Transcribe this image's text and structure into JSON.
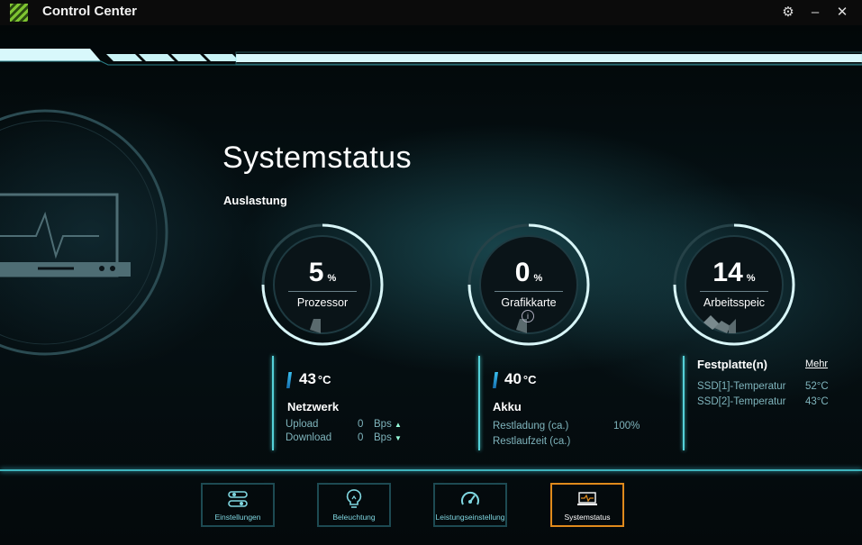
{
  "window": {
    "title": "Control Center",
    "settings_glyph": "⚙",
    "minimize_glyph": "–",
    "close_glyph": "✕"
  },
  "section": {
    "title": "Systemstatus",
    "subtitle": "Auslastung"
  },
  "gauges": [
    {
      "value": "5",
      "unit": "%",
      "label": "Prozessor",
      "level": 0.05
    },
    {
      "value": "0",
      "unit": "%",
      "label": "Grafikkarte",
      "level": 0.0,
      "info_glyph": "i"
    },
    {
      "value": "14",
      "unit": "%",
      "label": "Arbeitsspeic",
      "level": 0.14
    }
  ],
  "cpu_block": {
    "temp_value": "43",
    "temp_unit": "°C",
    "title": "Netzwerk",
    "upload_label": "Upload",
    "upload_value": "0",
    "upload_unit": "Bps",
    "download_label": "Download",
    "download_value": "0",
    "download_unit": "Bps",
    "up_arrow": "▲",
    "down_arrow": "▼"
  },
  "gpu_block": {
    "temp_value": "40",
    "temp_unit": "°C",
    "title": "Akku",
    "charge_label": "Restladung (ca.)",
    "charge_value": "100%",
    "runtime_label": "Restlaufzeit (ca.)"
  },
  "disk_block": {
    "title": "Festplatte(n)",
    "more_link": "Mehr",
    "rows": [
      {
        "label": "SSD[1]-Temperatur",
        "value": "52°C"
      },
      {
        "label": "SSD[2]-Temperatur",
        "value": "43°C"
      }
    ]
  },
  "nav": [
    {
      "label": "Einstellungen",
      "icon": "toggle-switches-icon"
    },
    {
      "label": "Beleuchtung",
      "icon": "light-bulb-icon"
    },
    {
      "label": "Leistungseinstellung",
      "icon": "speedometer-icon"
    },
    {
      "label": "Systemstatus",
      "icon": "laptop-pulse-icon",
      "active": true
    }
  ],
  "colors": {
    "accent": "#55d0d8",
    "active": "#e08a1c",
    "logo": "#7fc532"
  }
}
